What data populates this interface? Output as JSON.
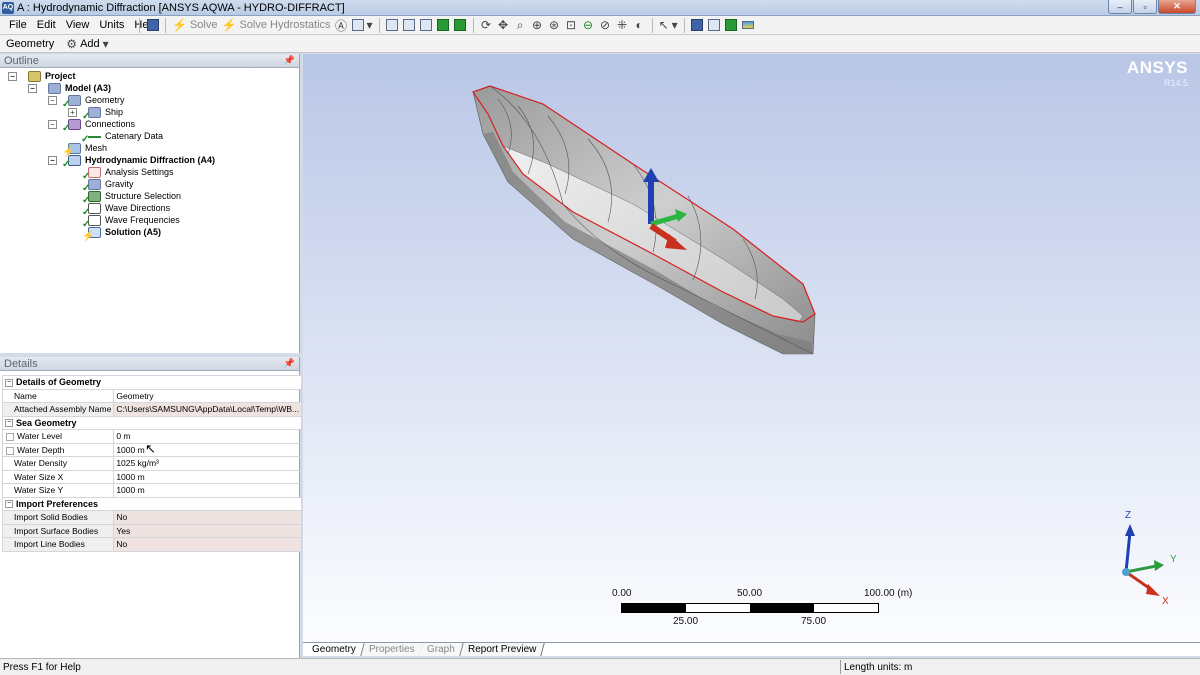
{
  "window": {
    "title": "A : Hydrodynamic Diffraction [ANSYS AQWA - HYDRO-DIFFRACT]",
    "app_icon": "AQ",
    "controls": {
      "minimize": "–",
      "maximize": "▫",
      "close": "✕"
    }
  },
  "menu": {
    "items": [
      "File",
      "Edit",
      "View",
      "Units",
      "Help"
    ]
  },
  "toolbar": {
    "solve_label": "Solve",
    "solve_hydrostatics_label": "Solve Hydrostatics",
    "icons": [
      "save-icon",
      "solve-icon",
      "solve-hydrostatics-icon",
      "annotation-icon",
      "view-select-icon",
      "new-page-icon",
      "copy-icon",
      "paste-icon",
      "green-box-icon",
      "green-box-2-icon",
      "rotate-icon",
      "pan-icon",
      "zoom-icon",
      "zoom-in-icon",
      "zoom-fit-icon",
      "zoom-box-icon",
      "zoom-out-icon",
      "zoom-extent-icon",
      "iso-icon",
      "look-at-icon",
      "select-mode-icon",
      "cube-icon",
      "cube-outline-icon",
      "green-cube-icon",
      "legend-icon"
    ]
  },
  "toolbar2": {
    "geometry_label": "Geometry",
    "add_label": "Add"
  },
  "outline": {
    "header": "Outline",
    "tree": [
      {
        "label": "Project",
        "bold": true
      },
      {
        "label": "Model (A3)",
        "bold": true
      },
      {
        "label": "Geometry"
      },
      {
        "label": "Ship"
      },
      {
        "label": "Connections"
      },
      {
        "label": "Catenary Data"
      },
      {
        "label": "Mesh"
      },
      {
        "label": "Hydrodynamic Diffraction (A4)",
        "bold": true
      },
      {
        "label": "Analysis Settings"
      },
      {
        "label": "Gravity"
      },
      {
        "label": "Structure Selection"
      },
      {
        "label": "Wave Directions"
      },
      {
        "label": "Wave Frequencies"
      },
      {
        "label": "Solution (A5)",
        "bold": true
      }
    ]
  },
  "details": {
    "header": "Details",
    "sections": {
      "geometry": {
        "title": "Details of Geometry",
        "rows": [
          {
            "key": "Name",
            "value": "Geometry"
          },
          {
            "key": "Attached Assembly Name",
            "value": "C:\\Users\\SAMSUNG\\AppData\\Local\\Temp\\WB..."
          }
        ]
      },
      "sea": {
        "title": "Sea Geometry",
        "rows": [
          {
            "key": "Water Level",
            "value": "0 m"
          },
          {
            "key": "Water Depth",
            "value": "1000 m"
          },
          {
            "key": "Water Density",
            "value": "1025 kg/m³"
          },
          {
            "key": "Water Size X",
            "value": "1000 m"
          },
          {
            "key": "Water Size Y",
            "value": "1000 m"
          }
        ]
      },
      "import": {
        "title": "Import Preferences",
        "rows": [
          {
            "key": "Import Solid Bodies",
            "value": "No"
          },
          {
            "key": "Import Surface Bodies",
            "value": "Yes"
          },
          {
            "key": "Import Line Bodies",
            "value": "No"
          }
        ]
      }
    }
  },
  "viewport": {
    "brand": "ANSYS",
    "version": "R14.5",
    "scale": {
      "top": [
        "0.00",
        "50.00",
        "100.00 (m)"
      ],
      "bottom": [
        "25.00",
        "75.00"
      ]
    },
    "triad": {
      "z": "Z",
      "y": "Y",
      "x": "X"
    }
  },
  "tabs": [
    "Geometry",
    "Properties",
    "Graph",
    "Report Preview"
  ],
  "status": {
    "help": "Press F1 for Help",
    "units": "Length units: m"
  },
  "colors": {
    "accent": "#2f5f9f",
    "viewport_top": "#b9c6e6",
    "viewport_bottom": "#fcfdff",
    "hull_edge": "#d62020"
  }
}
